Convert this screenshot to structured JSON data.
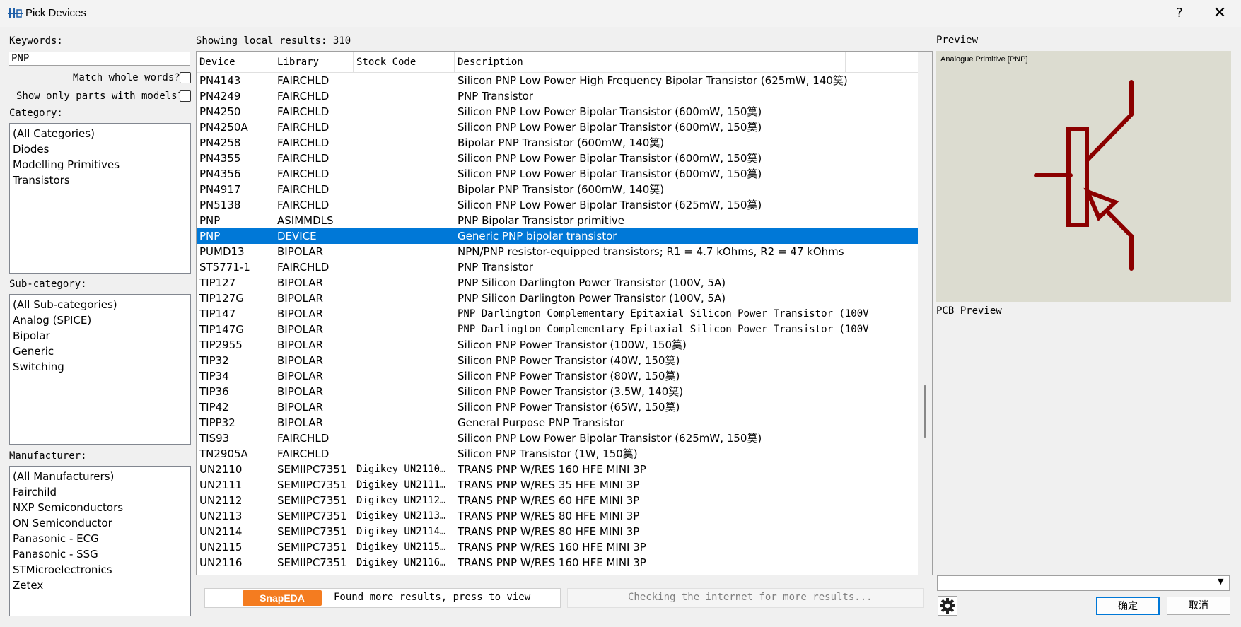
{
  "window": {
    "title": "Pick Devices",
    "help": "?",
    "close": "✕"
  },
  "left": {
    "keywords_label": "Keywords:",
    "keywords_value": "PNP",
    "match_whole_words": "Match whole words?",
    "show_only_models": "Show only parts with models?",
    "category_label": "Category:",
    "categories": [
      "(All Categories)",
      "Diodes",
      "Modelling Primitives",
      "Transistors"
    ],
    "subcategory_label": "Sub-category:",
    "subcategories": [
      "(All Sub-categories)",
      "Analog (SPICE)",
      "Bipolar",
      "Generic",
      "Switching"
    ],
    "manufacturer_label": "Manufacturer:",
    "manufacturers": [
      "(All Manufacturers)",
      "Fairchild",
      "NXP Semiconductors",
      "ON Semiconductor",
      "Panasonic - ECG",
      "Panasonic - SSG",
      "STMicroelectronics",
      "Zetex"
    ]
  },
  "results": {
    "summary": "Showing local results: 310",
    "columns": [
      "Device",
      "Library",
      "Stock Code",
      "Description"
    ],
    "rows": [
      {
        "device": "PN4143",
        "library": "FAIRCHLD",
        "stock": "",
        "desc": "Silicon PNP Low Power High Frequency Bipolar Transistor (625mW, 140筽)"
      },
      {
        "device": "PN4249",
        "library": "FAIRCHLD",
        "stock": "",
        "desc": "PNP Transistor"
      },
      {
        "device": "PN4250",
        "library": "FAIRCHLD",
        "stock": "",
        "desc": "Silicon PNP Low Power Bipolar Transistor (600mW, 150筽)"
      },
      {
        "device": "PN4250A",
        "library": "FAIRCHLD",
        "stock": "",
        "desc": "Silicon PNP Low Power Bipolar Transistor (600mW, 150筽)"
      },
      {
        "device": "PN4258",
        "library": "FAIRCHLD",
        "stock": "",
        "desc": "Bipolar PNP Transistor (600mW, 140筽)"
      },
      {
        "device": "PN4355",
        "library": "FAIRCHLD",
        "stock": "",
        "desc": "Silicon PNP Low Power Bipolar Transistor (600mW, 150筽)"
      },
      {
        "device": "PN4356",
        "library": "FAIRCHLD",
        "stock": "",
        "desc": "Silicon PNP Low Power Bipolar Transistor (600mW, 150筽)"
      },
      {
        "device": "PN4917",
        "library": "FAIRCHLD",
        "stock": "",
        "desc": "Bipolar PNP Transistor (600mW, 140筽)"
      },
      {
        "device": "PN5138",
        "library": "FAIRCHLD",
        "stock": "",
        "desc": "Silicon PNP Low Power Bipolar Transistor (625mW, 150筽)"
      },
      {
        "device": "PNP",
        "library": "ASIMMDLS",
        "stock": "",
        "desc": "PNP Bipolar Transistor primitive"
      },
      {
        "device": "PNP",
        "library": "DEVICE",
        "stock": "",
        "desc": "Generic PNP bipolar transistor",
        "selected": true
      },
      {
        "device": "PUMD13",
        "library": "BIPOLAR",
        "stock": "",
        "desc": "NPN/PNP resistor-equipped transistors; R1 = 4.7 kOhms, R2 = 47 kOhms"
      },
      {
        "device": "ST5771-1",
        "library": "FAIRCHLD",
        "stock": "",
        "desc": "PNP Transistor"
      },
      {
        "device": "TIP127",
        "library": "BIPOLAR",
        "stock": "",
        "desc": "PNP Silicon Darlington Power Transistor (100V, 5A)"
      },
      {
        "device": "TIP127G",
        "library": "BIPOLAR",
        "stock": "",
        "desc": "PNP Silicon Darlington Power Transistor (100V, 5A)"
      },
      {
        "device": "TIP147",
        "library": "BIPOLAR",
        "stock": "",
        "desc": "PNP Darlington Complementary Epitaxial Silicon Power Transistor (100V",
        "mono": true
      },
      {
        "device": "TIP147G",
        "library": "BIPOLAR",
        "stock": "",
        "desc": "PNP Darlington Complementary Epitaxial Silicon Power Transistor (100V",
        "mono": true
      },
      {
        "device": "TIP2955",
        "library": "BIPOLAR",
        "stock": "",
        "desc": "Silicon PNP Power Transistor (100W, 150筽)"
      },
      {
        "device": "TIP32",
        "library": "BIPOLAR",
        "stock": "",
        "desc": "Silicon PNP Power Transistor (40W, 150筽)"
      },
      {
        "device": "TIP34",
        "library": "BIPOLAR",
        "stock": "",
        "desc": "Silicon PNP Power Transistor (80W, 150筽)"
      },
      {
        "device": "TIP36",
        "library": "BIPOLAR",
        "stock": "",
        "desc": "Silicon PNP Power Transistor (3.5W, 140筽)"
      },
      {
        "device": "TIP42",
        "library": "BIPOLAR",
        "stock": "",
        "desc": "Silicon PNP Power Transistor (65W, 150筽)"
      },
      {
        "device": "TIPP32",
        "library": "BIPOLAR",
        "stock": "",
        "desc": "General Purpose PNP Transistor"
      },
      {
        "device": "TIS93",
        "library": "FAIRCHLD",
        "stock": "",
        "desc": "Silicon PNP Low Power Bipolar Transistor (625mW, 150筽)"
      },
      {
        "device": "TN2905A",
        "library": "FAIRCHLD",
        "stock": "",
        "desc": "Silicon PNP Transistor (1W, 150筽)"
      },
      {
        "device": "UN2110",
        "library": "SEMIIPC7351",
        "stock": "Digikey UN2110…",
        "desc": "TRANS PNP W/RES 160 HFE MINI 3P"
      },
      {
        "device": "UN2111",
        "library": "SEMIIPC7351",
        "stock": "Digikey UN2111…",
        "desc": "TRANS PNP W/RES 35 HFE MINI 3P"
      },
      {
        "device": "UN2112",
        "library": "SEMIIPC7351",
        "stock": "Digikey UN2112…",
        "desc": "TRANS PNP W/RES 60 HFE MINI 3P"
      },
      {
        "device": "UN2113",
        "library": "SEMIIPC7351",
        "stock": "Digikey UN2113…",
        "desc": "TRANS PNP W/RES 80 HFE MINI 3P"
      },
      {
        "device": "UN2114",
        "library": "SEMIIPC7351",
        "stock": "Digikey UN2114…",
        "desc": "TRANS PNP W/RES 80 HFE MINI 3P"
      },
      {
        "device": "UN2115",
        "library": "SEMIIPC7351",
        "stock": "Digikey UN2115…",
        "desc": "TRANS PNP W/RES 160 HFE MINI 3P"
      },
      {
        "device": "UN2116",
        "library": "SEMIIPC7351",
        "stock": "Digikey UN2116…",
        "desc": "TRANS PNP W/RES 160 HFE MINI 3P"
      }
    ]
  },
  "bottom": {
    "snapeda_logo": "SnapEDA",
    "found_more": "Found more results, press to view",
    "checking": "Checking the internet for more results..."
  },
  "preview": {
    "label": "Preview",
    "caption": "Analogue Primitive [PNP]",
    "pcb_label": "PCB Preview",
    "symbol_color": "#8b0000",
    "background": "#dcdcd0"
  },
  "buttons": {
    "ok": "确定",
    "cancel": "取消",
    "settings_icon": "gear-icon"
  }
}
